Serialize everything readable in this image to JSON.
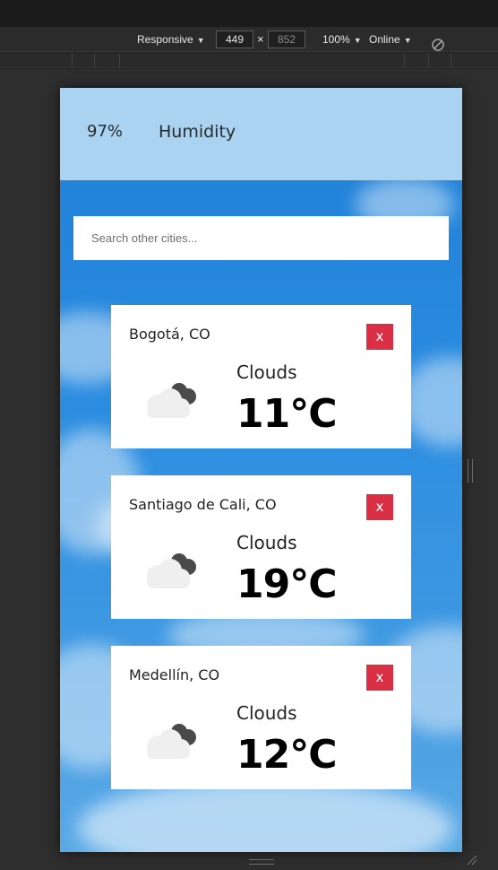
{
  "devtools": {
    "device_mode": "Responsive",
    "width": "449",
    "height": "852",
    "times": "×",
    "zoom": "100%",
    "network": "Online"
  },
  "humidity": {
    "value": "97%",
    "label": "Humidity"
  },
  "search": {
    "placeholder": "Search other cities..."
  },
  "cards": [
    {
      "city": "Bogotá, CO",
      "condition": "Clouds",
      "temp": "11°C",
      "close_label": "x",
      "icon": "cloud-icon"
    },
    {
      "city": "Santiago de Cali, CO",
      "condition": "Clouds",
      "temp": "19°C",
      "close_label": "x",
      "icon": "cloud-icon"
    },
    {
      "city": "Medellín, CO",
      "condition": "Clouds",
      "temp": "12°C",
      "close_label": "x",
      "icon": "cloud-icon"
    }
  ],
  "colors": {
    "humidity_band": "#a9d3f0",
    "close_button": "#d93045",
    "sky": "#2a8ce0"
  }
}
